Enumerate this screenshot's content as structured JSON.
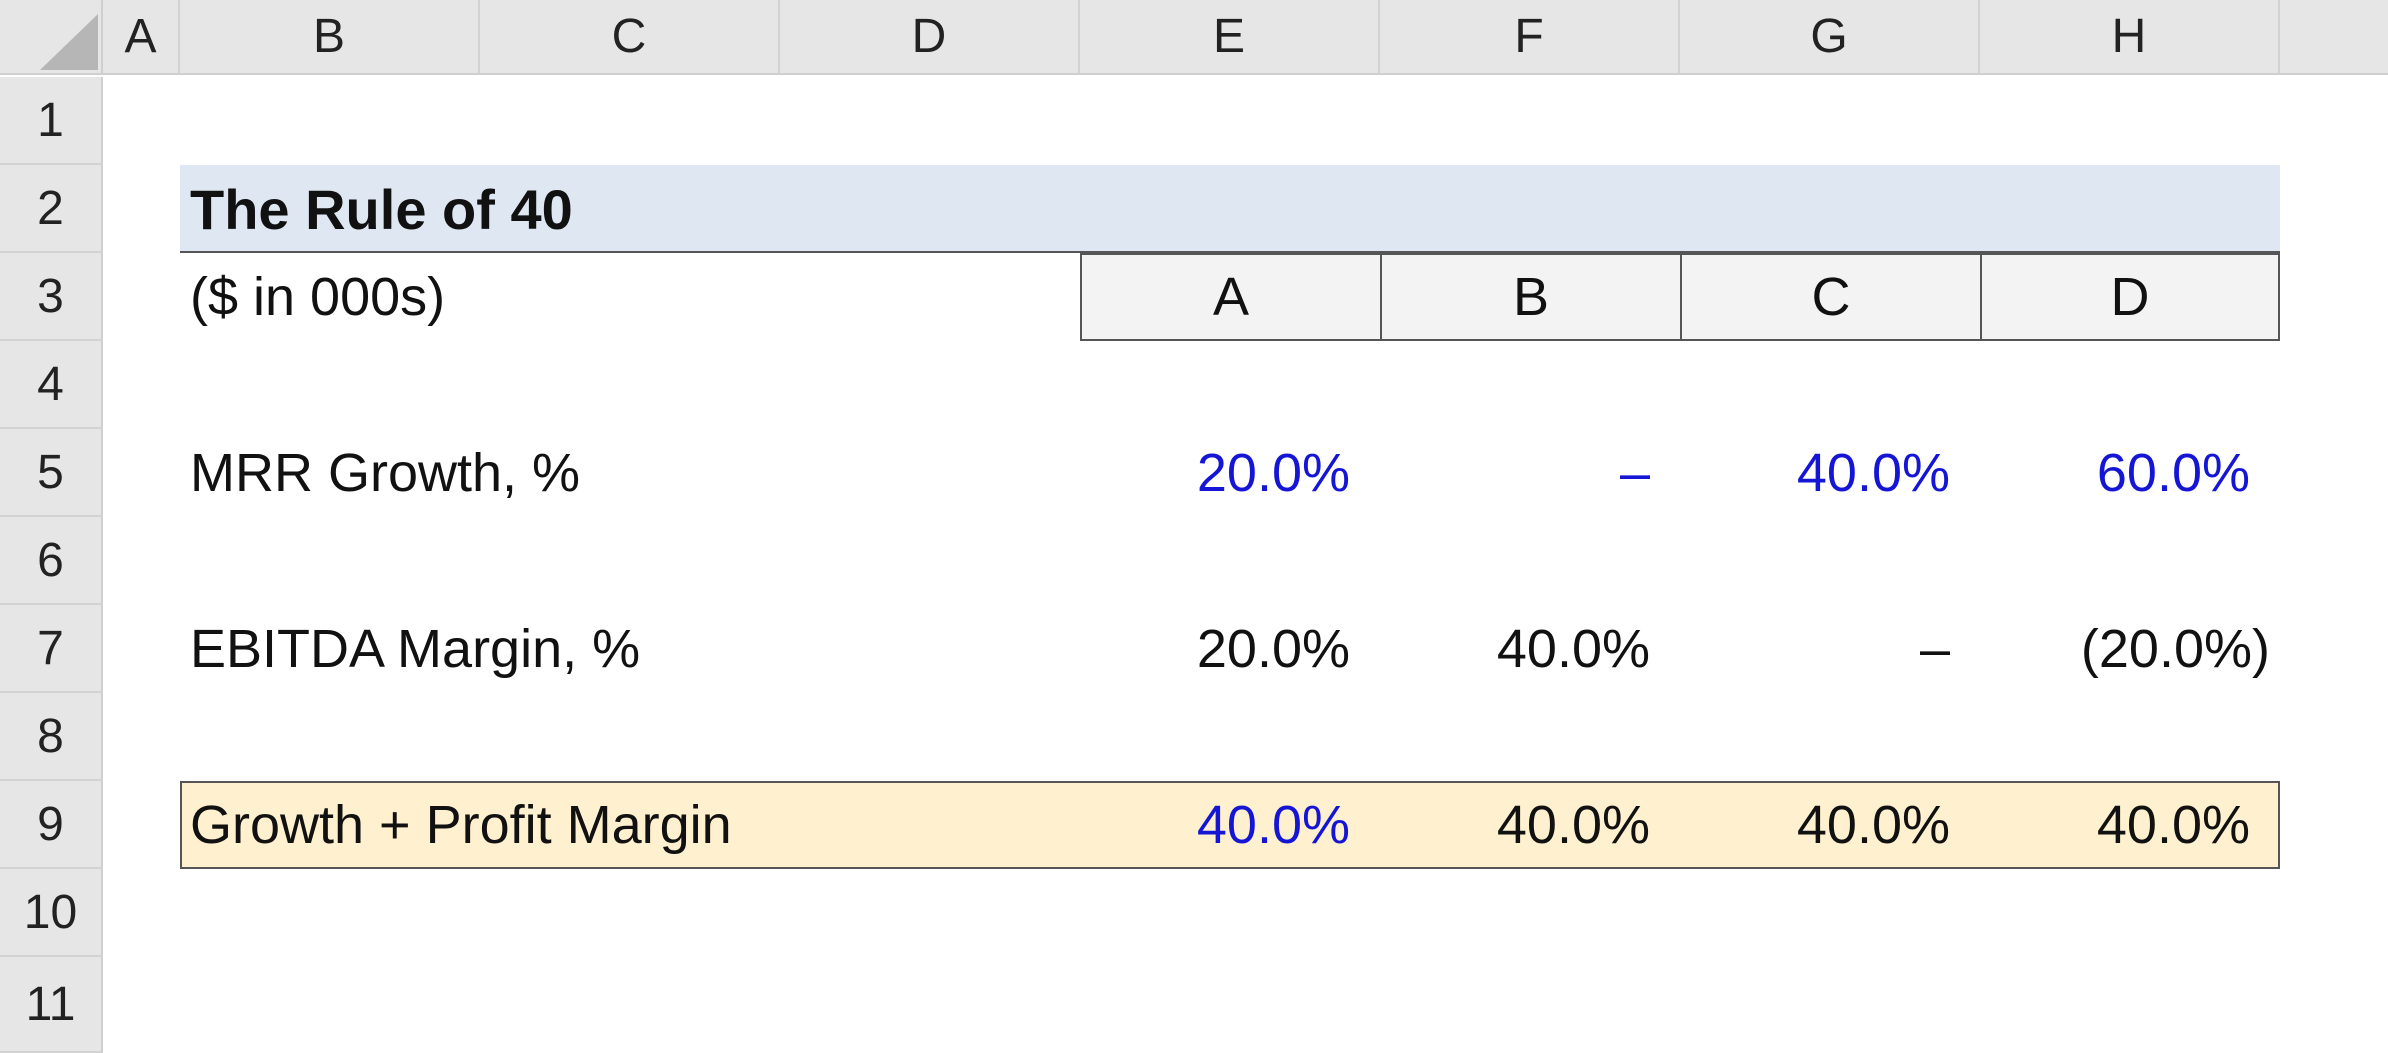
{
  "columns": [
    "A",
    "B",
    "C",
    "D",
    "E",
    "F",
    "G",
    "H"
  ],
  "rows": [
    "1",
    "2",
    "3",
    "4",
    "5",
    "6",
    "7",
    "8",
    "9",
    "10",
    "11"
  ],
  "sheet": {
    "title": "The Rule of 40",
    "units": "($ in 000s)",
    "companies": [
      "A",
      "B",
      "C",
      "D"
    ],
    "mrr_growth": {
      "label": "MRR Growth, %",
      "values": [
        "20.0%",
        "–",
        "40.0%",
        "60.0%"
      ]
    },
    "ebitda_margin": {
      "label": "EBITDA Margin, %",
      "values": [
        "20.0%",
        "40.0%",
        "–",
        "(20.0%)"
      ]
    },
    "rule_of_40": {
      "label": "Growth + Profit Margin",
      "values": [
        "40.0%",
        "40.0%",
        "40.0%",
        "40.0%"
      ]
    }
  },
  "colors": {
    "input_blue": "#1515d6",
    "title_fill": "#dfe8f2",
    "total_fill": "#fff1cf",
    "header_gray": "#e6e6e6"
  }
}
